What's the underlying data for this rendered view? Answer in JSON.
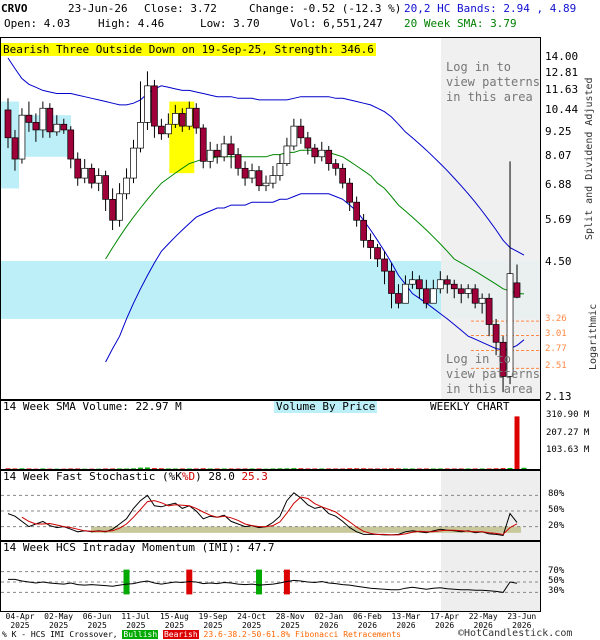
{
  "header": {
    "ticker": "CRVO",
    "date": "23-Jun-26",
    "close": "Close: 3.72",
    "change": "Change: -0.52 (-12.3 %)",
    "bands": "20,2 HC Bands: 2.94 , 4.89",
    "open": "Open: 4.03",
    "high": "High: 4.46",
    "low": "Low: 3.70",
    "vol": "Vol: 6,551,247",
    "sma": "20 Week SMA: 3.79"
  },
  "pattern_banner": "Bearish Three Outside Down on 19-Sep-25, Strength: 346.6",
  "login_text_top": [
    "Log in to",
    "view patterns",
    "in this area"
  ],
  "login_text_bottom": [
    "Log in to",
    "view patterns",
    "in this area"
  ],
  "right_axis_title": "Split and Dividend Adjusted",
  "log_label": "Logarithmic",
  "volume_label": "14 Week SMA Volume: 22.97 M",
  "vbp_label": "Volume By Price",
  "weekly_label": "WEEKLY CHART",
  "stoch_label_prefix": "14 Week Fast Stochastic (",
  "stoch_k": "%K",
  "stoch_d": "%D",
  "stoch_values_prefix": ") 28.0 ",
  "stoch_d_value": "25.3",
  "imi_label": "14 Week HCS Intraday Momentum (IMI): 47.7",
  "footer_left": "% K - HCS IMI Crossover,",
  "footer_bullish": "Bullish",
  "footer_bearish": "Bearish",
  "footer_fib": "23.6-38.2-50-61.8% Fibonacci Retracements",
  "footer_copy": "©HotCandlestick.com",
  "colors": {
    "bull": "#ffffff",
    "bear": "#a0003a",
    "band": "#0000cc",
    "sma": "#008800",
    "vbp": "#bdeff8",
    "login_bg": "#eeeeee",
    "fib": "#ff8844",
    "pattern_hl": "#ffff00"
  },
  "chart_data": [
    {
      "type": "candlestick",
      "title": "CRVO",
      "scale": "log",
      "ylim": [
        2.13,
        14.0
      ],
      "y_ticks": [
        "14.00",
        "12.81",
        "11.63",
        "10.44",
        "9.25",
        "8.07",
        "6.88",
        "5.69",
        "4.50",
        "3.26",
        "3.01",
        "2.77",
        "2.51",
        "2.13"
      ],
      "y_tick_values": [
        14.0,
        12.81,
        11.63,
        10.44,
        9.25,
        8.07,
        6.88,
        5.69,
        4.5,
        3.26,
        3.01,
        2.77,
        2.51,
        2.13
      ],
      "fib_levels": [
        3.26,
        3.01,
        2.77,
        2.51
      ],
      "x_labels": [
        "04-Apr\n2025",
        "02-May\n2025",
        "06-Jun\n2025",
        "11-Jul\n2025",
        "15-Aug\n2025",
        "19-Sep\n2025",
        "24-Oct\n2025",
        "28-Nov\n2025",
        "02-Jan\n2026",
        "06-Feb\n2026",
        "13-Mar\n2026",
        "17-Apr\n2026",
        "22-May\n2026",
        "23-Jun\n2026"
      ],
      "candles": [
        [
          10.5,
          9.0,
          11.2,
          8.5
        ],
        [
          9.0,
          8.0,
          9.4,
          7.5
        ],
        [
          8.0,
          10.2,
          10.6,
          7.8
        ],
        [
          10.2,
          9.8,
          11.0,
          9.3
        ],
        [
          9.8,
          9.4,
          10.3,
          8.8
        ],
        [
          9.4,
          10.6,
          11.0,
          9.0
        ],
        [
          10.6,
          9.3,
          10.9,
          9.0
        ],
        [
          9.3,
          9.7,
          10.2,
          9.1
        ],
        [
          9.7,
          9.4,
          10.0,
          9.2
        ],
        [
          9.4,
          8.0,
          9.6,
          7.6
        ],
        [
          8.0,
          7.2,
          8.3,
          6.9
        ],
        [
          7.2,
          7.6,
          8.0,
          7.0
        ],
        [
          7.6,
          7.0,
          7.8,
          6.8
        ],
        [
          7.0,
          7.3,
          7.6,
          6.7
        ],
        [
          7.3,
          6.4,
          7.5,
          6.0
        ],
        [
          6.4,
          5.7,
          6.8,
          5.4
        ],
        [
          5.7,
          6.6,
          7.0,
          5.5
        ],
        [
          6.6,
          7.2,
          7.6,
          6.4
        ],
        [
          7.2,
          8.5,
          8.9,
          7.0
        ],
        [
          8.5,
          9.8,
          12.3,
          8.3
        ],
        [
          9.8,
          12.0,
          13.0,
          9.4
        ],
        [
          12.0,
          9.6,
          12.4,
          9.0
        ],
        [
          9.6,
          9.2,
          10.0,
          8.9
        ],
        [
          9.2,
          9.7,
          10.3,
          9.0
        ],
        [
          9.7,
          10.3,
          10.8,
          9.5
        ],
        [
          10.3,
          9.6,
          10.6,
          9.3
        ],
        [
          9.6,
          10.6,
          11.0,
          9.4
        ],
        [
          10.6,
          9.5,
          10.9,
          9.2
        ],
        [
          9.5,
          7.9,
          9.7,
          7.6
        ],
        [
          7.9,
          8.4,
          8.8,
          7.6
        ],
        [
          8.4,
          8.1,
          8.7,
          7.8
        ],
        [
          8.1,
          8.7,
          9.1,
          7.9
        ],
        [
          8.7,
          8.2,
          9.1,
          7.6
        ],
        [
          8.2,
          7.6,
          8.5,
          7.3
        ],
        [
          7.6,
          7.2,
          7.9,
          6.9
        ],
        [
          7.2,
          7.5,
          7.8,
          7.0
        ],
        [
          7.5,
          6.9,
          7.7,
          6.7
        ],
        [
          6.9,
          7.0,
          7.3,
          6.7
        ],
        [
          7.0,
          7.3,
          7.7,
          6.8
        ],
        [
          7.3,
          7.8,
          8.2,
          7.1
        ],
        [
          7.8,
          8.6,
          9.0,
          7.7
        ],
        [
          8.6,
          9.6,
          10.0,
          8.4
        ],
        [
          9.6,
          9.0,
          10.0,
          8.7
        ],
        [
          9.0,
          8.5,
          9.3,
          8.2
        ],
        [
          8.5,
          8.1,
          8.7,
          7.8
        ],
        [
          8.1,
          8.4,
          8.8,
          7.9
        ],
        [
          8.4,
          7.8,
          8.6,
          7.5
        ],
        [
          7.8,
          7.6,
          8.0,
          7.3
        ],
        [
          7.6,
          7.0,
          7.8,
          6.8
        ],
        [
          7.0,
          6.3,
          7.2,
          6.0
        ],
        [
          6.3,
          5.7,
          6.5,
          5.5
        ],
        [
          5.7,
          5.1,
          5.9,
          4.9
        ],
        [
          5.1,
          4.9,
          5.3,
          4.6
        ],
        [
          4.9,
          4.6,
          5.0,
          4.4
        ],
        [
          4.6,
          4.3,
          4.8,
          4.0
        ],
        [
          4.3,
          3.8,
          4.5,
          3.5
        ],
        [
          3.8,
          3.6,
          4.0,
          3.5
        ],
        [
          3.6,
          4.0,
          4.2,
          3.6
        ],
        [
          4.0,
          4.1,
          4.3,
          3.9
        ],
        [
          4.1,
          3.9,
          4.2,
          3.7
        ],
        [
          3.9,
          3.6,
          4.1,
          3.5
        ],
        [
          3.6,
          3.9,
          4.1,
          3.7
        ],
        [
          3.9,
          4.1,
          4.3,
          3.8
        ],
        [
          4.1,
          4.0,
          4.2,
          3.8
        ],
        [
          4.0,
          3.9,
          4.1,
          3.7
        ],
        [
          3.9,
          3.8,
          4.0,
          3.6
        ],
        [
          3.8,
          3.9,
          4.0,
          3.7
        ],
        [
          3.9,
          3.6,
          4.0,
          3.5
        ],
        [
          3.6,
          3.7,
          3.8,
          3.4
        ],
        [
          3.7,
          3.2,
          3.8,
          3.0
        ],
        [
          3.2,
          2.9,
          3.3,
          2.7
        ],
        [
          2.9,
          2.4,
          3.0,
          2.2
        ],
        [
          2.4,
          4.24,
          7.9,
          2.3
        ],
        [
          4.03,
          3.72,
          4.46,
          3.7
        ]
      ],
      "upper_band": [
        14.0,
        13.2,
        12.5,
        12.1,
        11.9,
        11.7,
        11.6,
        11.5,
        11.5,
        11.5,
        11.4,
        11.3,
        11.2,
        11.1,
        11.0,
        10.9,
        10.8,
        10.8,
        10.9,
        11.1,
        11.5,
        11.8,
        12.0,
        11.9,
        11.8,
        11.7,
        11.7,
        11.6,
        11.5,
        11.4,
        11.3,
        11.3,
        11.3,
        11.2,
        11.2,
        11.2,
        11.1,
        11.1,
        11.1,
        11.1,
        11.1,
        11.2,
        11.3,
        11.3,
        11.3,
        11.3,
        11.3,
        11.2,
        11.2,
        11.1,
        11.0,
        10.9,
        10.8,
        10.6,
        10.4,
        10.1,
        9.7,
        9.3,
        9.0,
        8.7,
        8.4,
        8.1,
        7.8,
        7.5,
        7.2,
        6.9,
        6.6,
        6.3,
        6.0,
        5.7,
        5.4,
        5.1,
        4.9,
        4.8,
        4.7
      ],
      "lower_band": [
        null,
        null,
        null,
        null,
        null,
        null,
        null,
        null,
        null,
        null,
        null,
        null,
        null,
        null,
        2.6,
        2.8,
        3.0,
        3.3,
        3.6,
        3.9,
        4.2,
        4.5,
        4.8,
        5.0,
        5.2,
        5.4,
        5.6,
        5.8,
        5.9,
        6.0,
        6.1,
        6.1,
        6.2,
        6.2,
        6.2,
        6.3,
        6.3,
        6.3,
        6.3,
        6.4,
        6.4,
        6.5,
        6.6,
        6.6,
        6.6,
        6.6,
        6.6,
        6.5,
        6.4,
        6.2,
        6.0,
        5.7,
        5.4,
        5.1,
        4.8,
        4.5,
        4.2,
        4.0,
        3.8,
        3.7,
        3.6,
        3.5,
        3.4,
        3.3,
        3.2,
        3.1,
        3.0,
        2.95,
        2.9,
        2.85,
        2.8,
        2.78,
        2.8,
        2.85,
        2.94
      ],
      "sma20": [
        null,
        null,
        null,
        null,
        null,
        null,
        null,
        null,
        null,
        null,
        null,
        null,
        null,
        null,
        4.6,
        4.9,
        5.2,
        5.5,
        5.8,
        6.1,
        6.4,
        6.7,
        7.0,
        7.2,
        7.4,
        7.6,
        7.8,
        7.9,
        8.0,
        8.0,
        8.1,
        8.1,
        8.1,
        8.1,
        8.1,
        8.1,
        8.1,
        8.1,
        8.2,
        8.2,
        8.3,
        8.3,
        8.4,
        8.4,
        8.4,
        8.3,
        8.3,
        8.2,
        8.1,
        7.9,
        7.7,
        7.5,
        7.3,
        7.0,
        6.8,
        6.5,
        6.2,
        6.0,
        5.8,
        5.6,
        5.4,
        5.2,
        5.0,
        4.8,
        4.6,
        4.5,
        4.4,
        4.3,
        4.2,
        4.1,
        4.0,
        3.9,
        3.85,
        3.8,
        3.79
      ]
    },
    {
      "type": "bar",
      "title": "14 Week SMA Volume: 22.97 M",
      "y_ticks": [
        "310.90 M",
        "207.27 M",
        "103.63 M"
      ],
      "ylim": [
        0,
        330
      ],
      "values": [
        4,
        3,
        4,
        3,
        2,
        3,
        2,
        2,
        2,
        3,
        3,
        2,
        2,
        2,
        3,
        3,
        3,
        3,
        4,
        8,
        9,
        5,
        4,
        3,
        3,
        3,
        3,
        3,
        4,
        3,
        3,
        3,
        3,
        3,
        3,
        3,
        3,
        2,
        3,
        4,
        4,
        5,
        4,
        3,
        3,
        3,
        3,
        3,
        3,
        4,
        4,
        4,
        3,
        3,
        3,
        4,
        3,
        3,
        3,
        3,
        3,
        3,
        3,
        3,
        3,
        3,
        3,
        3,
        3,
        3,
        4,
        5,
        6,
        310,
        7
      ]
    },
    {
      "type": "line",
      "title": "14 Week Fast Stochastic",
      "y_ticks": [
        "80%",
        "50%",
        "20%"
      ],
      "ylim": [
        0,
        100
      ],
      "k": [
        45,
        40,
        30,
        20,
        25,
        30,
        22,
        18,
        20,
        15,
        10,
        12,
        10,
        12,
        10,
        15,
        25,
        35,
        55,
        70,
        80,
        60,
        58,
        62,
        65,
        55,
        60,
        50,
        35,
        40,
        38,
        42,
        30,
        25,
        20,
        22,
        18,
        20,
        28,
        40,
        70,
        85,
        75,
        62,
        55,
        58,
        45,
        40,
        30,
        18,
        10,
        5,
        5,
        5,
        4,
        4,
        5,
        10,
        12,
        10,
        8,
        12,
        15,
        13,
        12,
        10,
        12,
        8,
        10,
        6,
        5,
        3,
        45,
        28
      ],
      "d": [
        null,
        null,
        38,
        30,
        25,
        25,
        26,
        23,
        20,
        18,
        15,
        12,
        11,
        11,
        11,
        12,
        17,
        25,
        38,
        53,
        68,
        70,
        66,
        60,
        62,
        61,
        60,
        55,
        48,
        42,
        38,
        40,
        37,
        32,
        25,
        22,
        20,
        20,
        22,
        29,
        46,
        65,
        77,
        74,
        64,
        58,
        53,
        48,
        38,
        29,
        19,
        11,
        7,
        5,
        5,
        4,
        4,
        6,
        9,
        11,
        10,
        10,
        12,
        13,
        13,
        12,
        11,
        10,
        10,
        8,
        7,
        5,
        18,
        25.3
      ]
    },
    {
      "type": "line",
      "title": "14 Week HCS Intraday Momentum (IMI): 47.7",
      "y_ticks": [
        "70%",
        "50%",
        "30%"
      ],
      "ylim": [
        0,
        100
      ],
      "values": [
        55,
        55,
        52,
        50,
        48,
        50,
        48,
        47,
        46,
        48,
        45,
        44,
        45,
        44,
        43,
        42,
        44,
        46,
        47,
        50,
        52,
        48,
        46,
        48,
        50,
        49,
        51,
        50,
        47,
        48,
        47,
        49,
        48,
        46,
        45,
        46,
        44,
        45,
        46,
        48,
        51,
        53,
        52,
        50,
        49,
        51,
        48,
        47,
        45,
        44,
        42,
        40,
        38,
        37,
        36,
        35,
        35,
        38,
        40,
        38,
        36,
        38,
        39,
        37,
        36,
        35,
        35,
        34,
        34,
        33,
        32,
        30,
        50,
        47.7
      ],
      "bullish_crossovers": [
        17,
        36
      ],
      "bearish_crossovers": [
        26,
        40
      ]
    }
  ]
}
